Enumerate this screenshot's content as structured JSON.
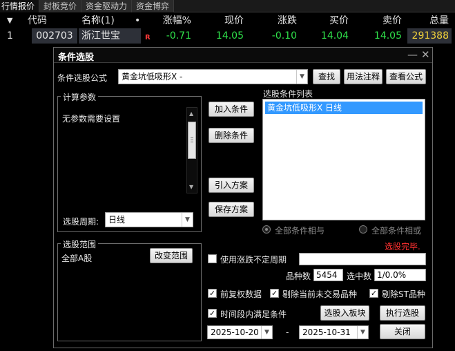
{
  "tabs": [
    {
      "label": "行情报价"
    },
    {
      "label": "封板竞价"
    },
    {
      "label": "资金驱动力"
    },
    {
      "label": "资金博弈"
    }
  ],
  "quote_table": {
    "sort_marker": "▼",
    "headers": [
      "代码",
      "名称(1)",
      "•",
      "涨幅%",
      "现价",
      "涨跌",
      "买价",
      "卖价",
      "总量"
    ],
    "row": {
      "index": "1",
      "code": "002703",
      "name": "浙江世宝",
      "badge": "R",
      "change_pct": "-0.71",
      "price": "14.05",
      "change": "-0.10",
      "bid": "14.04",
      "ask": "14.05",
      "volume": "291388"
    }
  },
  "dialog": {
    "title": "条件选股",
    "minimize_glyph": "—",
    "close_glyph": "✕",
    "formula_label": "条件选股公式",
    "formula_value": "黄金坑低吸形X  -",
    "find_button": "查找",
    "usage_button": "用法注释",
    "view_formula_button": "查看公式",
    "params_group_title": "计算参数",
    "params_text": "无参数需要设置",
    "period_label": "选股周期:",
    "period_value": "日线",
    "add_condition_button": "加入条件",
    "delete_condition_button": "删除条件",
    "import_plan_button": "引入方案",
    "save_plan_button": "保存方案",
    "conditions_list_label": "选股条件列表",
    "conditions": [
      "黄金坑低吸形X  日线"
    ],
    "all_and_label": "全部条件相与",
    "all_or_label": "全部条件相或",
    "status_text": "选股完毕.",
    "scope_group_title": "选股范围",
    "scope_value": "全部A股",
    "change_scope_button": "改变范围",
    "use_variable_period_label": "使用涨跌不定周期",
    "count_label": "品种数",
    "count_value": "5454",
    "selected_label": "选中数",
    "selected_value": "1/0.0%",
    "adjusted_label": "前复权数据",
    "exclude_untraded_label": "剔除当前未交易品种",
    "exclude_st_label": "剔除ST品种",
    "time_range_label": "时间段内满足条件",
    "to_board_button": "选股入板块",
    "execute_button": "执行选股",
    "start_date": "2025-10-20",
    "date_separator": "-",
    "end_date": "2025-10-31",
    "close_button": "关闭"
  },
  "colors": {
    "up_green": "#2fe04a",
    "volume_yellow": "#f2d23a",
    "status_red": "#ff3030",
    "selection_blue": "#3399ff"
  }
}
